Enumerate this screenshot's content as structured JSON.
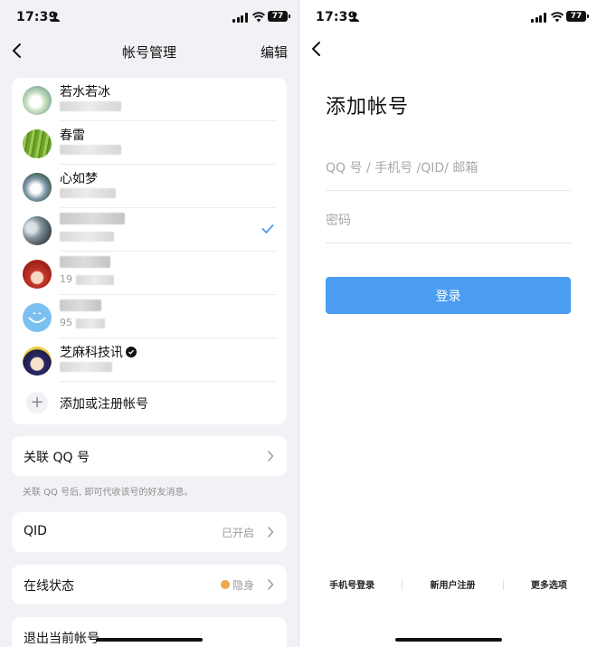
{
  "colors": {
    "accent": "#4a9df1",
    "page_bg": "#f1f2f5",
    "status_dot": "#f0a64f"
  },
  "left": {
    "status": {
      "time": "17:39",
      "battery": "77"
    },
    "nav": {
      "title": "帐号管理",
      "edit": "编辑"
    },
    "accounts": [
      {
        "name": "若水若冰",
        "sub": ""
      },
      {
        "name": "春雷",
        "sub": ""
      },
      {
        "name": "心如梦",
        "sub": ""
      },
      {
        "name": "",
        "sub": ""
      },
      {
        "name": "",
        "sub": "19"
      },
      {
        "name": "",
        "sub": "95"
      },
      {
        "name": "芝麻科技讯",
        "sub": ""
      }
    ],
    "add_account": "添加或注册帐号",
    "link_qq": {
      "label": "关联 QQ 号",
      "hint": "关联 QQ 号后, 即可代收该号的好友消息。"
    },
    "qid": {
      "label": "QID",
      "value": "已开启"
    },
    "online": {
      "label": "在线状态",
      "value": "隐身"
    },
    "logout": "退出当前帐号"
  },
  "right": {
    "status": {
      "time": "17:39",
      "battery": "77"
    },
    "title": "添加帐号",
    "account_placeholder": "QQ 号 / 手机号 /QID/ 邮箱",
    "password_placeholder": "密码",
    "login": "登录",
    "links": [
      "手机号登录",
      "新用户注册",
      "更多选项"
    ]
  }
}
